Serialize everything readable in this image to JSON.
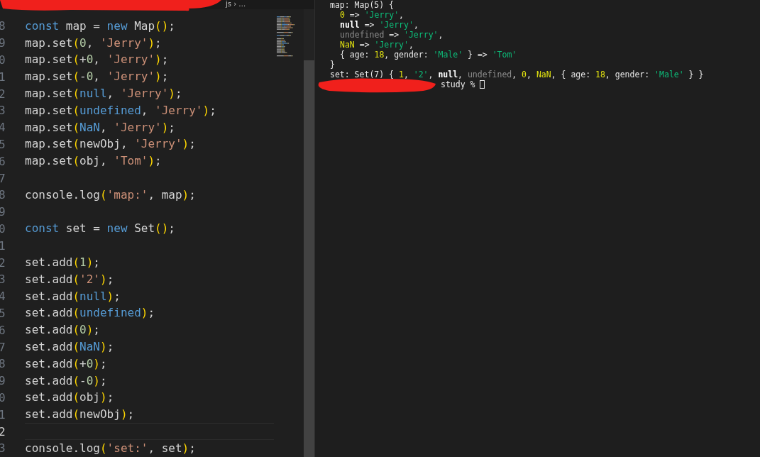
{
  "editor": {
    "breadcrumb": "js › …",
    "lines": [
      {
        "number": "8",
        "active": false,
        "tokens": [
          {
            "kind": "kw",
            "text": "const"
          },
          {
            "kind": "p",
            "text": " map = "
          },
          {
            "kind": "kw",
            "text": "new"
          },
          {
            "kind": "p",
            "text": " Map"
          },
          {
            "kind": "par",
            "text": "()"
          },
          {
            "kind": "p",
            "text": ";"
          }
        ]
      },
      {
        "number": "9",
        "active": false,
        "tokens": [
          {
            "kind": "p",
            "text": "map.set"
          },
          {
            "kind": "par",
            "text": "("
          },
          {
            "kind": "num",
            "text": "0"
          },
          {
            "kind": "p",
            "text": ", "
          },
          {
            "kind": "str",
            "text": "'Jerry'"
          },
          {
            "kind": "par",
            "text": ")"
          },
          {
            "kind": "p",
            "text": ";"
          }
        ]
      },
      {
        "number": "0",
        "active": false,
        "tokens": [
          {
            "kind": "p",
            "text": "map.set"
          },
          {
            "kind": "par",
            "text": "("
          },
          {
            "kind": "p",
            "text": "+"
          },
          {
            "kind": "num",
            "text": "0"
          },
          {
            "kind": "p",
            "text": ", "
          },
          {
            "kind": "str",
            "text": "'Jerry'"
          },
          {
            "kind": "par",
            "text": ")"
          },
          {
            "kind": "p",
            "text": ";"
          }
        ]
      },
      {
        "number": "1",
        "active": false,
        "tokens": [
          {
            "kind": "p",
            "text": "map.set"
          },
          {
            "kind": "par",
            "text": "("
          },
          {
            "kind": "p",
            "text": "-"
          },
          {
            "kind": "num",
            "text": "0"
          },
          {
            "kind": "p",
            "text": ", "
          },
          {
            "kind": "str",
            "text": "'Jerry'"
          },
          {
            "kind": "par",
            "text": ")"
          },
          {
            "kind": "p",
            "text": ";"
          }
        ]
      },
      {
        "number": "2",
        "active": false,
        "tokens": [
          {
            "kind": "p",
            "text": "map.set"
          },
          {
            "kind": "par",
            "text": "("
          },
          {
            "kind": "lit",
            "text": "null"
          },
          {
            "kind": "p",
            "text": ", "
          },
          {
            "kind": "str",
            "text": "'Jerry'"
          },
          {
            "kind": "par",
            "text": ")"
          },
          {
            "kind": "p",
            "text": ";"
          }
        ]
      },
      {
        "number": "3",
        "active": false,
        "tokens": [
          {
            "kind": "p",
            "text": "map.set"
          },
          {
            "kind": "par",
            "text": "("
          },
          {
            "kind": "lit",
            "text": "undefined"
          },
          {
            "kind": "p",
            "text": ", "
          },
          {
            "kind": "str",
            "text": "'Jerry'"
          },
          {
            "kind": "par",
            "text": ")"
          },
          {
            "kind": "p",
            "text": ";"
          }
        ]
      },
      {
        "number": "4",
        "active": false,
        "tokens": [
          {
            "kind": "p",
            "text": "map.set"
          },
          {
            "kind": "par",
            "text": "("
          },
          {
            "kind": "lit",
            "text": "NaN"
          },
          {
            "kind": "p",
            "text": ", "
          },
          {
            "kind": "str",
            "text": "'Jerry'"
          },
          {
            "kind": "par",
            "text": ")"
          },
          {
            "kind": "p",
            "text": ";"
          }
        ]
      },
      {
        "number": "5",
        "active": false,
        "tokens": [
          {
            "kind": "p",
            "text": "map.set"
          },
          {
            "kind": "par",
            "text": "("
          },
          {
            "kind": "p",
            "text": "newObj, "
          },
          {
            "kind": "str",
            "text": "'Jerry'"
          },
          {
            "kind": "par",
            "text": ")"
          },
          {
            "kind": "p",
            "text": ";"
          }
        ]
      },
      {
        "number": "6",
        "active": false,
        "tokens": [
          {
            "kind": "p",
            "text": "map.set"
          },
          {
            "kind": "par",
            "text": "("
          },
          {
            "kind": "p",
            "text": "obj, "
          },
          {
            "kind": "str",
            "text": "'Tom'"
          },
          {
            "kind": "par",
            "text": ")"
          },
          {
            "kind": "p",
            "text": ";"
          }
        ]
      },
      {
        "number": "7",
        "active": false
      },
      {
        "number": "8",
        "active": false,
        "tokens": [
          {
            "kind": "p",
            "text": "console.log"
          },
          {
            "kind": "par",
            "text": "("
          },
          {
            "kind": "str",
            "text": "'map:'"
          },
          {
            "kind": "p",
            "text": ", map"
          },
          {
            "kind": "par",
            "text": ")"
          },
          {
            "kind": "p",
            "text": ";"
          }
        ]
      },
      {
        "number": "9",
        "active": false
      },
      {
        "number": "0",
        "active": false,
        "tokens": [
          {
            "kind": "kw",
            "text": "const"
          },
          {
            "kind": "p",
            "text": " set = "
          },
          {
            "kind": "kw",
            "text": "new"
          },
          {
            "kind": "p",
            "text": " Set"
          },
          {
            "kind": "par",
            "text": "()"
          },
          {
            "kind": "p",
            "text": ";"
          }
        ]
      },
      {
        "number": "1",
        "active": false
      },
      {
        "number": "2",
        "active": false,
        "tokens": [
          {
            "kind": "p",
            "text": "set.add"
          },
          {
            "kind": "par",
            "text": "("
          },
          {
            "kind": "num",
            "text": "1"
          },
          {
            "kind": "par",
            "text": ")"
          },
          {
            "kind": "p",
            "text": ";"
          }
        ]
      },
      {
        "number": "3",
        "active": false,
        "tokens": [
          {
            "kind": "p",
            "text": "set.add"
          },
          {
            "kind": "par",
            "text": "("
          },
          {
            "kind": "str",
            "text": "'2'"
          },
          {
            "kind": "par",
            "text": ")"
          },
          {
            "kind": "p",
            "text": ";"
          }
        ]
      },
      {
        "number": "4",
        "active": false,
        "tokens": [
          {
            "kind": "p",
            "text": "set.add"
          },
          {
            "kind": "par",
            "text": "("
          },
          {
            "kind": "lit",
            "text": "null"
          },
          {
            "kind": "par",
            "text": ")"
          },
          {
            "kind": "p",
            "text": ";"
          }
        ]
      },
      {
        "number": "5",
        "active": false,
        "tokens": [
          {
            "kind": "p",
            "text": "set.add"
          },
          {
            "kind": "par",
            "text": "("
          },
          {
            "kind": "lit",
            "text": "undefined"
          },
          {
            "kind": "par",
            "text": ")"
          },
          {
            "kind": "p",
            "text": ";"
          }
        ]
      },
      {
        "number": "6",
        "active": false,
        "tokens": [
          {
            "kind": "p",
            "text": "set.add"
          },
          {
            "kind": "par",
            "text": "("
          },
          {
            "kind": "num",
            "text": "0"
          },
          {
            "kind": "par",
            "text": ")"
          },
          {
            "kind": "p",
            "text": ";"
          }
        ]
      },
      {
        "number": "7",
        "active": false,
        "tokens": [
          {
            "kind": "p",
            "text": "set.add"
          },
          {
            "kind": "par",
            "text": "("
          },
          {
            "kind": "lit",
            "text": "NaN"
          },
          {
            "kind": "par",
            "text": ")"
          },
          {
            "kind": "p",
            "text": ";"
          }
        ]
      },
      {
        "number": "8",
        "active": false,
        "tokens": [
          {
            "kind": "p",
            "text": "set.add"
          },
          {
            "kind": "par",
            "text": "("
          },
          {
            "kind": "p",
            "text": "+"
          },
          {
            "kind": "num",
            "text": "0"
          },
          {
            "kind": "par",
            "text": ")"
          },
          {
            "kind": "p",
            "text": ";"
          }
        ]
      },
      {
        "number": "9",
        "active": false,
        "tokens": [
          {
            "kind": "p",
            "text": "set.add"
          },
          {
            "kind": "par",
            "text": "("
          },
          {
            "kind": "p",
            "text": "-"
          },
          {
            "kind": "num",
            "text": "0"
          },
          {
            "kind": "par",
            "text": ")"
          },
          {
            "kind": "p",
            "text": ";"
          }
        ]
      },
      {
        "number": "0",
        "active": false,
        "tokens": [
          {
            "kind": "p",
            "text": "set.add"
          },
          {
            "kind": "par",
            "text": "("
          },
          {
            "kind": "p",
            "text": "obj"
          },
          {
            "kind": "par",
            "text": ")"
          },
          {
            "kind": "p",
            "text": ";"
          }
        ]
      },
      {
        "number": "1",
        "active": false,
        "tokens": [
          {
            "kind": "p",
            "text": "set.add"
          },
          {
            "kind": "par",
            "text": "("
          },
          {
            "kind": "p",
            "text": "newObj"
          },
          {
            "kind": "par",
            "text": ")"
          },
          {
            "kind": "p",
            "text": ";"
          }
        ]
      },
      {
        "number": "2",
        "active": true
      },
      {
        "number": "3",
        "active": false,
        "tokens": [
          {
            "kind": "p",
            "text": "console.log"
          },
          {
            "kind": "par",
            "text": "("
          },
          {
            "kind": "str",
            "text": "'set:'"
          },
          {
            "kind": "p",
            "text": ", set"
          },
          {
            "kind": "par",
            "text": ")"
          },
          {
            "kind": "p",
            "text": ";"
          }
        ]
      }
    ]
  },
  "terminal": {
    "lines": [
      {
        "kind": "output",
        "indented": false,
        "tokens": [
          {
            "kind": "p",
            "text": "map: Map(5) {"
          }
        ]
      },
      {
        "kind": "output",
        "indented": true,
        "tokens": [
          {
            "kind": "num",
            "text": "0"
          },
          {
            "kind": "p",
            "text": " => "
          },
          {
            "kind": "str",
            "text": "'Jerry'"
          },
          {
            "kind": "p",
            "text": ","
          }
        ]
      },
      {
        "kind": "output",
        "indented": true,
        "tokens": [
          {
            "kind": "bold",
            "text": "null"
          },
          {
            "kind": "p",
            "text": " => "
          },
          {
            "kind": "str",
            "text": "'Jerry'"
          },
          {
            "kind": "p",
            "text": ","
          }
        ]
      },
      {
        "kind": "output",
        "indented": true,
        "tokens": [
          {
            "kind": "dim",
            "text": "undefined"
          },
          {
            "kind": "p",
            "text": " => "
          },
          {
            "kind": "str",
            "text": "'Jerry'"
          },
          {
            "kind": "p",
            "text": ","
          }
        ]
      },
      {
        "kind": "output",
        "indented": true,
        "tokens": [
          {
            "kind": "num",
            "text": "NaN"
          },
          {
            "kind": "p",
            "text": " => "
          },
          {
            "kind": "str",
            "text": "'Jerry'"
          },
          {
            "kind": "p",
            "text": ","
          }
        ]
      },
      {
        "kind": "output",
        "indented": true,
        "tokens": [
          {
            "kind": "p",
            "text": "{ age: "
          },
          {
            "kind": "num",
            "text": "18"
          },
          {
            "kind": "p",
            "text": ", gender: "
          },
          {
            "kind": "str",
            "text": "'Male'"
          },
          {
            "kind": "p",
            "text": " } => "
          },
          {
            "kind": "str",
            "text": "'Tom'"
          }
        ]
      },
      {
        "kind": "output",
        "indented": false,
        "tokens": [
          {
            "kind": "p",
            "text": "}"
          }
        ]
      },
      {
        "kind": "output",
        "indented": false,
        "tokens": [
          {
            "kind": "p",
            "text": "set: Set(7) { "
          },
          {
            "kind": "num",
            "text": "1"
          },
          {
            "kind": "p",
            "text": ", "
          },
          {
            "kind": "str",
            "text": "'2'"
          },
          {
            "kind": "p",
            "text": ", "
          },
          {
            "kind": "bold",
            "text": "null"
          },
          {
            "kind": "p",
            "text": ", "
          },
          {
            "kind": "dim",
            "text": "undefined"
          },
          {
            "kind": "p",
            "text": ", "
          },
          {
            "kind": "num",
            "text": "0"
          },
          {
            "kind": "p",
            "text": ", "
          },
          {
            "kind": "num",
            "text": "NaN"
          },
          {
            "kind": "p",
            "text": ", { age: "
          },
          {
            "kind": "num",
            "text": "18"
          },
          {
            "kind": "p",
            "text": ", gender: "
          },
          {
            "kind": "str",
            "text": "'Male'"
          },
          {
            "kind": "p",
            "text": " } }"
          }
        ]
      },
      {
        "kind": "prompt",
        "indented": false,
        "tokens": [
          {
            "kind": "p",
            "text": "study %"
          }
        ]
      }
    ]
  }
}
